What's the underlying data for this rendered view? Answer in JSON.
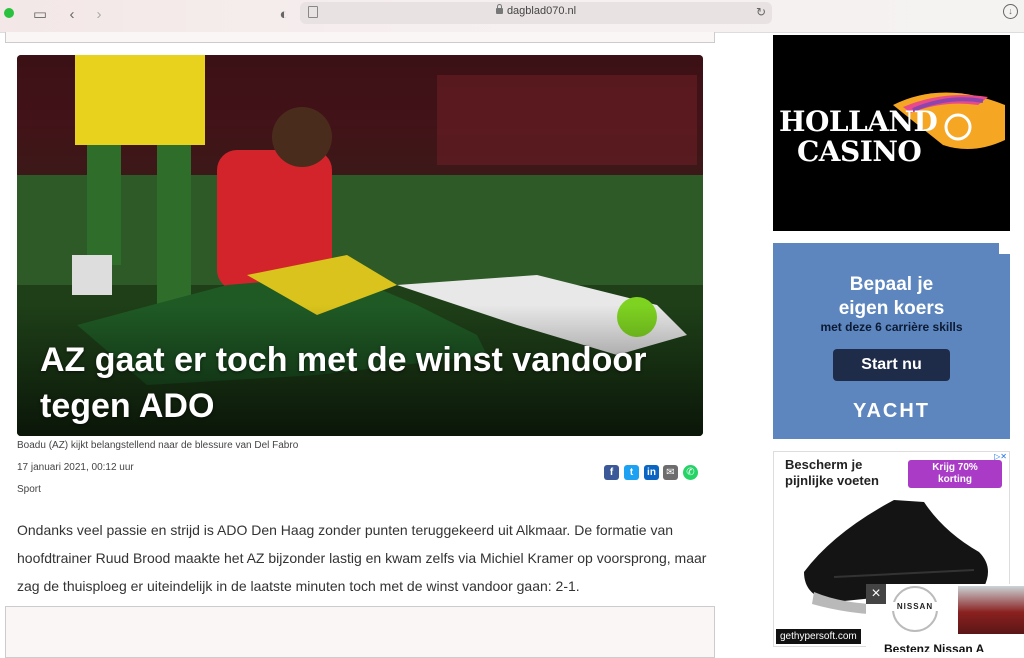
{
  "browser": {
    "url": "dagblad070.nl"
  },
  "article": {
    "title": "AZ gaat er toch met de winst vandoor tegen ADO",
    "caption": "Boadu (AZ) kijkt belangstellend naar de blessure van Del Fabro",
    "date": "17 januari 2021, 00:12 uur",
    "category": "Sport",
    "body": "Ondanks veel passie en strijd is ADO Den Haag zonder punten teruggekeerd uit Alkmaar. De formatie van hoofdtrainer Ruud Brood maakte het AZ bijzonder lastig en kwam zelfs via Michiel Kramer op voorsprong, maar zag de thuisploeg er uiteindelijk in de laatste minuten toch met de winst vandoor gaan: 2-1.",
    "share_icons": [
      "facebook-icon",
      "twitter-icon",
      "linkedin-icon",
      "mail-icon",
      "whatsapp-icon"
    ]
  },
  "ads": {
    "holland_casino": {
      "line1": "HOLLAND",
      "line2": "CASINO"
    },
    "yacht": {
      "headline_1": "Bepaal je",
      "headline_2": "eigen koers",
      "sub": "met deze 6 carrière skills",
      "cta": "Start nu",
      "brand": "YACHT",
      "color": "#5d86bf"
    },
    "shoe": {
      "head_1": "Bescherm je",
      "head_2": "pijnlijke voeten",
      "badge_1": "Krijg 70%",
      "badge_2": "korting",
      "domain": "gethypersoft.com"
    },
    "nissan": {
      "logo": "NISSAN",
      "headline": "Bestenz Nissan A",
      "close": "×"
    }
  }
}
